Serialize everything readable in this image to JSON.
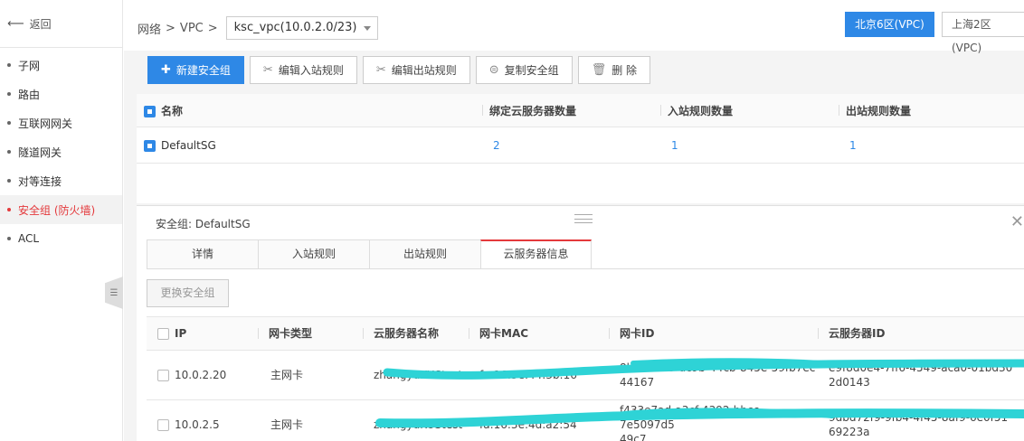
{
  "sidebar": {
    "back_label": "返回",
    "items": [
      {
        "label": "子网"
      },
      {
        "label": "路由"
      },
      {
        "label": "互联网网关"
      },
      {
        "label": "隧道网关"
      },
      {
        "label": "对等连接"
      },
      {
        "label": "安全组 (防火墙)",
        "active": true
      },
      {
        "label": "ACL"
      }
    ]
  },
  "header": {
    "crumb1": "网络",
    "sep": ">",
    "crumb2": "VPC",
    "vpc_selected": "ksc_vpc(10.0.2.0/23)",
    "regions": [
      {
        "label": "北京6区(VPC)",
        "active": true
      },
      {
        "label": "上海2区(VPC)",
        "active": false
      }
    ]
  },
  "toolbar": {
    "create": "新建安全组",
    "edit_in": "编辑入站规则",
    "edit_out": "编辑出站规则",
    "copy": "复制安全组",
    "delete": "删 除"
  },
  "sg_table": {
    "headers": [
      "名称",
      "绑定云服务器数量",
      "入站规则数量",
      "出站规则数量"
    ],
    "rows": [
      {
        "name": "DefaultSG",
        "servers": "2",
        "inbound": "1",
        "outbound": "1"
      }
    ]
  },
  "panel": {
    "title_prefix": "安全组:",
    "title_name": "DefaultSG",
    "tabs": [
      "详情",
      "入站规则",
      "出站规则",
      "云服务器信息"
    ],
    "change_button": "更换安全组",
    "headers": [
      "IP",
      "网卡类型",
      "云服务器名称",
      "网卡MAC",
      "网卡ID",
      "云服务器ID"
    ],
    "rows": [
      {
        "ip": "10.0.2.20",
        "type": "主网卡",
        "name": "zhangyuKUStest",
        "mac": "fa:16:3e:44:3b:16",
        "nic_id_1": "8b513b75-dc9b-44cb-845e-59fb7ec",
        "nic_id_2": "44167",
        "server_id_1": "e9f8d0e4-7ff6-4549-aca0-01bd30",
        "server_id_2": "2d0143"
      },
      {
        "ip": "10.0.2.5",
        "type": "主网卡",
        "name": "zhangyuKUStest",
        "mac": "fa:16:3e:4d:a2:54",
        "nic_id_1": "f433e7ad-a3cf-4392-bbcc-7e5097d5",
        "nic_id_2": "49c7",
        "server_id_1": "9dbd72f9-9fb4-4f45-8af9-6e0f51",
        "server_id_2": "69223a"
      }
    ]
  },
  "colors": {
    "primary": "#2e88e6",
    "active_red": "#e4393c",
    "redaction": "#2ed3d6"
  }
}
